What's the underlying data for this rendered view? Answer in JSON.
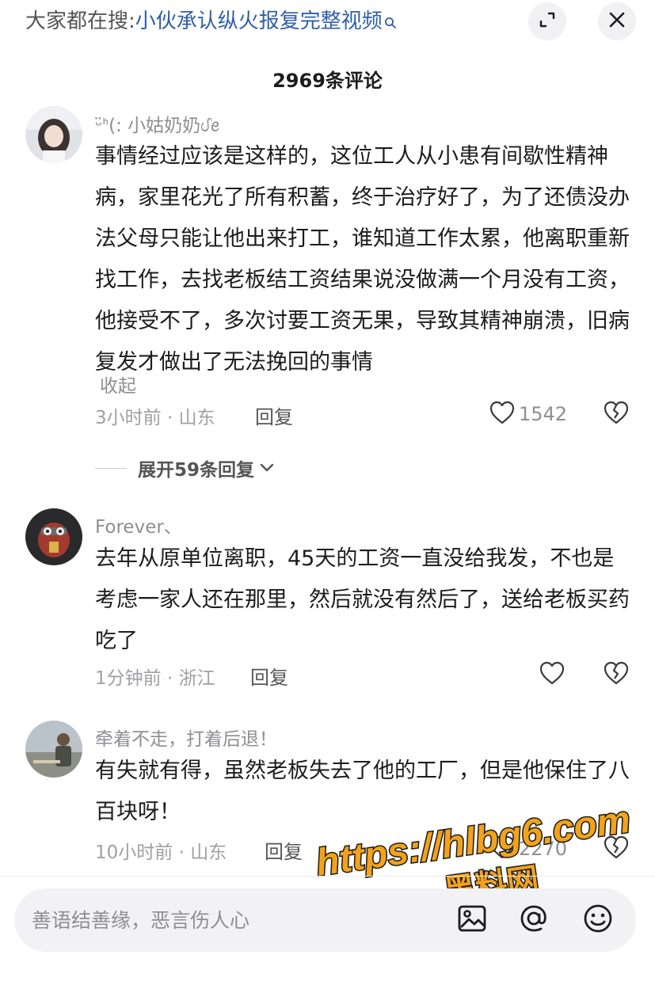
{
  "header": {
    "search_prefix": "大家都在搜:",
    "search_query": "小伙承认纵火报复完整视频",
    "comment_count": "2969条评论"
  },
  "comments": [
    {
      "username": "ᵕ̈ᑋ(: 小姑奶奶ᦔꫀ",
      "text": "事情经过应该是这样的，这位工人从小患有间歇性精神病，家里花光了所有积蓄，终于治疗好了，为了还债没办法父母只能让他出来打工，谁知道工作太累，他离职重新找工作，去找老板结工资结果说没做满一个月没有工资，他接受不了，多次讨要工资无果，导致其精神崩溃，旧病复发才做出了无法挽回的事情",
      "collapse": "收起",
      "meta": "3小时前 · 山东",
      "reply": "回复",
      "likes": "1542",
      "expand_replies": "展开59条回复"
    },
    {
      "username": "Forever、",
      "text": "去年从原单位离职，45天的工资一直没给我发，不也是考虑一家人还在那里，然后就没有然后了，送给老板买药吃了",
      "meta": "1分钟前 · 浙江",
      "reply": "回复"
    },
    {
      "username": "牵着不走，打着后退！",
      "text": "有失就有得，虽然老板失去了他的工厂，但是他保住了八百块呀！",
      "meta": "10小时前 · 山东",
      "reply": "回复",
      "likes": "2270"
    }
  ],
  "input": {
    "placeholder": "善语结善缘，恶言伤人心"
  },
  "watermark": {
    "url": "https://hlbg6.com",
    "name": "黑料网"
  },
  "icons": {
    "search_glass": "search-icon",
    "expand": "expand-icon",
    "close": "close-icon",
    "like": "heart-icon",
    "dislike": "broken-heart-icon",
    "image": "image-icon",
    "mention": "at-icon",
    "emoji": "emoji-icon"
  }
}
